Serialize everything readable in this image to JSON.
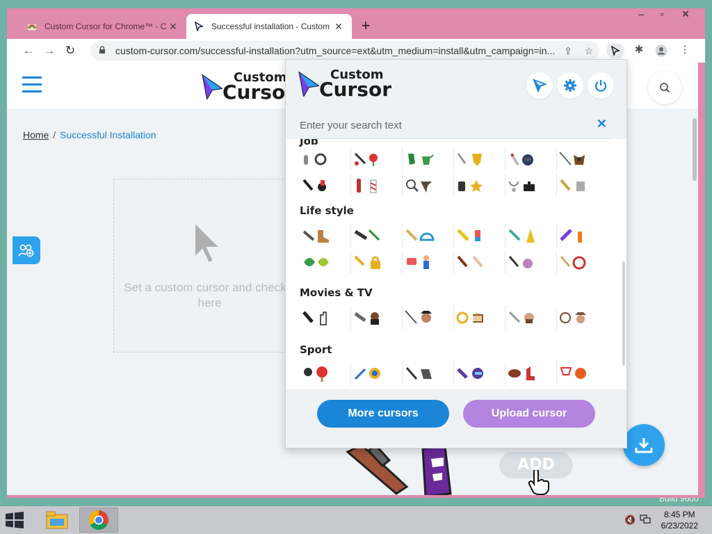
{
  "browser": {
    "tabs": [
      {
        "title": "Custom Cursor for Chrome™ - Ch",
        "active": false
      },
      {
        "title": "Successful installation - Custom C",
        "active": true
      }
    ],
    "new_tab": "+",
    "url": "custom-cursor.com/successful-installation?utm_source=ext&utm_medium=install&utm_campaign=in..."
  },
  "site": {
    "logo_line1": "Custom",
    "logo_line2": "Cursor",
    "breadcrumb": {
      "home": "Home",
      "separator": "/",
      "current": "Successful Installation"
    },
    "test_area_text": "Set a custom cursor and check it here",
    "add_button": "ADD"
  },
  "popup": {
    "logo_line1": "Custom",
    "logo_line2": "Cursor",
    "search_placeholder": "Enter your search text",
    "categories": {
      "job": "Job",
      "lifestyle": "Life style",
      "movies": "Movies & TV",
      "sport": "Sport"
    },
    "more_button": "More cursors",
    "upload_button": "Upload cursor"
  },
  "taskbar": {
    "time": "8:45 PM",
    "date": "6/23/2022"
  },
  "desktop": {
    "build": "Build 9600"
  },
  "colors": {
    "accent": "#1b86d8",
    "upload": "#b384e0",
    "frame": "#e08aae"
  }
}
